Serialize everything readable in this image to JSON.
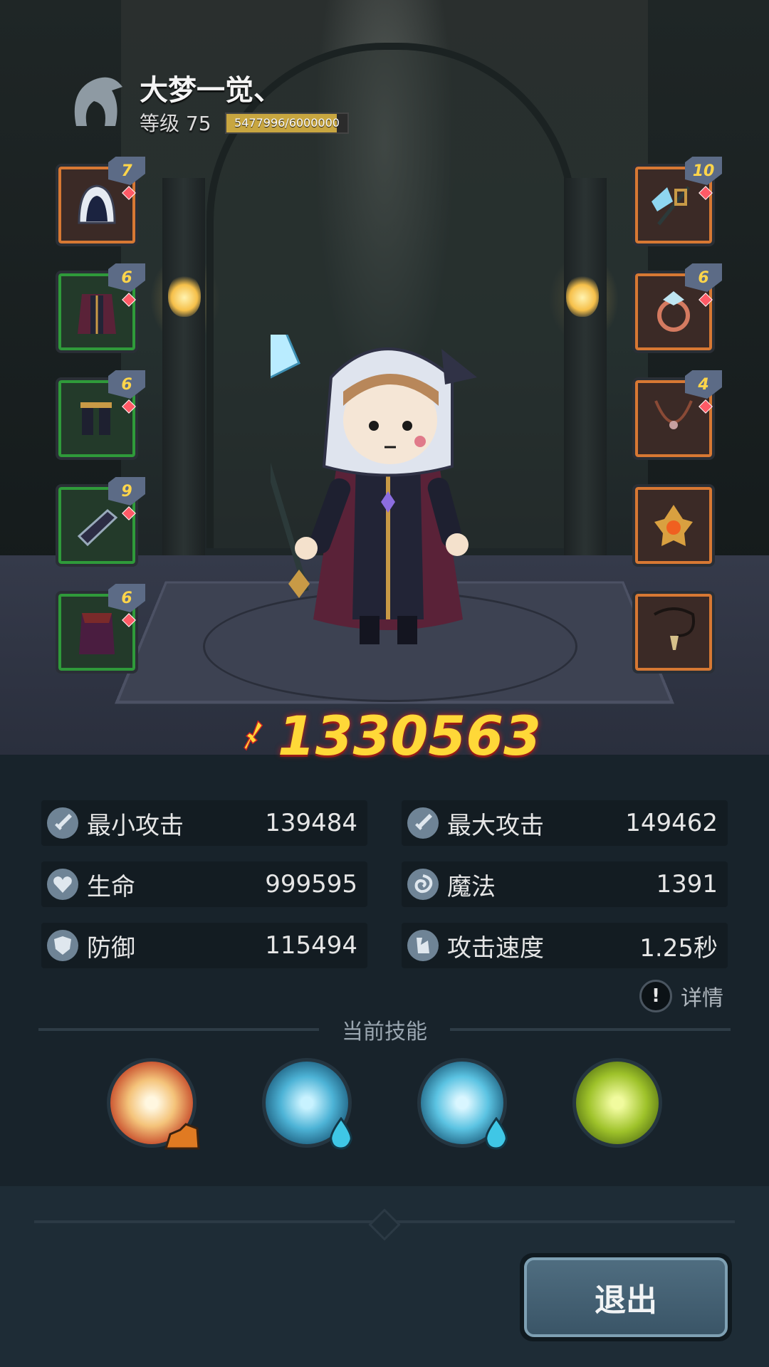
{
  "player": {
    "name": "大梦一觉、",
    "level_label": "等级 75",
    "exp_text": "5477996/6000000",
    "exp_fraction": 0.913
  },
  "equipment": {
    "left": [
      {
        "slot": "hood",
        "level": "7",
        "color": "orange"
      },
      {
        "slot": "robe",
        "level": "6",
        "color": "green"
      },
      {
        "slot": "boots",
        "level": "6",
        "color": "green"
      },
      {
        "slot": "bracer",
        "level": "9",
        "color": "green"
      },
      {
        "slot": "cape",
        "level": "6",
        "color": "green"
      }
    ],
    "right": [
      {
        "slot": "staff",
        "level": "10",
        "color": "orange"
      },
      {
        "slot": "ring",
        "level": "6",
        "color": "orange"
      },
      {
        "slot": "necklace",
        "level": "4",
        "color": "orange"
      },
      {
        "slot": "relic",
        "level": "",
        "color": "orange"
      },
      {
        "slot": "amulet",
        "level": "",
        "color": "orange"
      }
    ]
  },
  "combat_power": "1330563",
  "stats": {
    "min_attack": {
      "label": "最小攻击",
      "value": "139484",
      "icon": "sword-icon"
    },
    "max_attack": {
      "label": "最大攻击",
      "value": "149462",
      "icon": "sword-icon"
    },
    "hp": {
      "label": "生命",
      "value": "999595",
      "icon": "heart-icon"
    },
    "mp": {
      "label": "魔法",
      "value": "1391",
      "icon": "magic-icon"
    },
    "defense": {
      "label": "防御",
      "value": "115494",
      "icon": "shield-icon"
    },
    "attack_speed": {
      "label": "攻击速度",
      "value": "1.25秒",
      "icon": "speed-icon"
    }
  },
  "details_label": "详情",
  "skills_title": "当前技能",
  "skills": [
    {
      "name": "explosion-skill",
      "element": "earth"
    },
    {
      "name": "ice-shards-skill",
      "element": "water"
    },
    {
      "name": "ice-spikes-skill",
      "element": "water"
    },
    {
      "name": "poison-bubbles-skill",
      "element": "none"
    }
  ],
  "exit_label": "退出",
  "colors": {
    "power": "#ffd838",
    "slot_orange": "#d77833",
    "slot_green": "#2f9a3a",
    "exit_button": "#4f6d80"
  }
}
